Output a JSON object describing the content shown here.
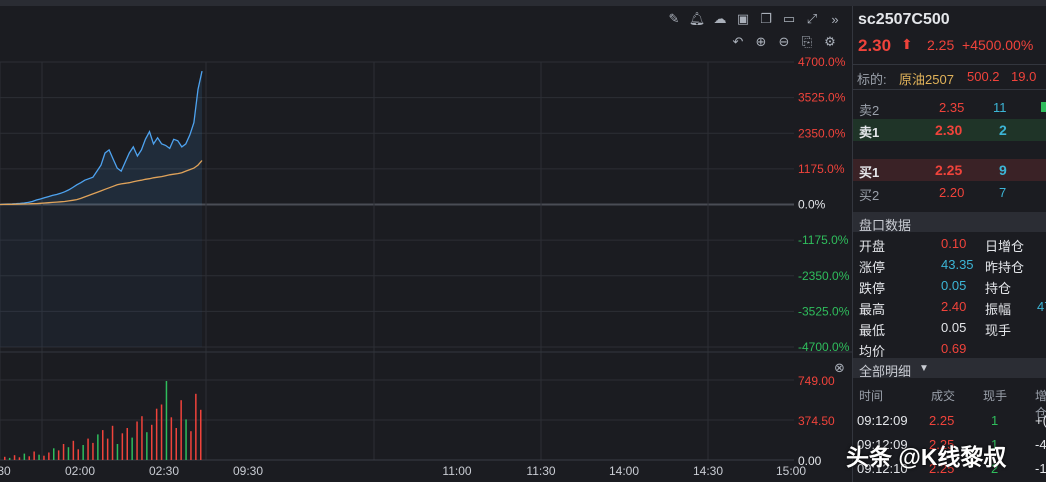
{
  "chart_data": {
    "type": "line",
    "x_ticks": [
      "30",
      "02:00",
      "02:30",
      "09:30",
      "11:00",
      "11:30",
      "14:00",
      "14:30",
      "15:00"
    ],
    "y_ticks_right": [
      "4700.0%",
      "3525.0%",
      "2350.0%",
      "1175.0%",
      "0.0%",
      "-1175.0%",
      "-2350.0%",
      "-3525.0%",
      "-4700.0%"
    ],
    "vol_ticks": [
      "749.00",
      "374.50",
      "0.00"
    ],
    "ylim": [
      -4700,
      4700
    ],
    "vol_max": 749,
    "series": [
      {
        "color": "#4ea3f0",
        "values": [
          0,
          10,
          15,
          20,
          25,
          35,
          50,
          70,
          100,
          150,
          180,
          220,
          260,
          300,
          330,
          370,
          420,
          480,
          560,
          650,
          720,
          800,
          850,
          900,
          1100,
          1300,
          1700,
          1800,
          1500,
          1200,
          1100,
          1400,
          1700,
          1900,
          1600,
          1800,
          2150,
          2400,
          2000,
          2200,
          2000,
          1950,
          1850,
          2150,
          2100,
          1900,
          2000,
          2300,
          2700,
          3800,
          4400
        ]
      },
      {
        "color": "#e0a35a",
        "values": [
          0,
          3,
          5,
          8,
          10,
          12,
          15,
          20,
          25,
          30,
          40,
          50,
          60,
          70,
          80,
          90,
          100,
          120,
          140,
          160,
          200,
          250,
          300,
          350,
          400,
          450,
          500,
          550,
          600,
          650,
          680,
          700,
          720,
          750,
          780,
          800,
          830,
          850,
          880,
          900,
          920,
          950,
          980,
          1000,
          1020,
          1050,
          1100,
          1150,
          1200,
          1300,
          1450
        ]
      }
    ],
    "volume": [
      {
        "v": 30,
        "c": "red"
      },
      {
        "v": 20,
        "c": "green"
      },
      {
        "v": 45,
        "c": "red"
      },
      {
        "v": 25,
        "c": "red"
      },
      {
        "v": 60,
        "c": "green"
      },
      {
        "v": 35,
        "c": "red"
      },
      {
        "v": 80,
        "c": "red"
      },
      {
        "v": 50,
        "c": "green"
      },
      {
        "v": 40,
        "c": "red"
      },
      {
        "v": 70,
        "c": "red"
      },
      {
        "v": 110,
        "c": "green"
      },
      {
        "v": 90,
        "c": "red"
      },
      {
        "v": 150,
        "c": "red"
      },
      {
        "v": 120,
        "c": "green"
      },
      {
        "v": 180,
        "c": "red"
      },
      {
        "v": 100,
        "c": "red"
      },
      {
        "v": 140,
        "c": "green"
      },
      {
        "v": 200,
        "c": "red"
      },
      {
        "v": 160,
        "c": "red"
      },
      {
        "v": 240,
        "c": "green"
      },
      {
        "v": 280,
        "c": "red"
      },
      {
        "v": 200,
        "c": "red"
      },
      {
        "v": 320,
        "c": "red"
      },
      {
        "v": 150,
        "c": "green"
      },
      {
        "v": 250,
        "c": "red"
      },
      {
        "v": 300,
        "c": "red"
      },
      {
        "v": 210,
        "c": "green"
      },
      {
        "v": 360,
        "c": "red"
      },
      {
        "v": 410,
        "c": "red"
      },
      {
        "v": 260,
        "c": "green"
      },
      {
        "v": 330,
        "c": "red"
      },
      {
        "v": 480,
        "c": "red"
      },
      {
        "v": 520,
        "c": "red"
      },
      {
        "v": 740,
        "c": "green"
      },
      {
        "v": 400,
        "c": "red"
      },
      {
        "v": 300,
        "c": "red"
      },
      {
        "v": 560,
        "c": "red"
      },
      {
        "v": 380,
        "c": "green"
      },
      {
        "v": 270,
        "c": "red"
      },
      {
        "v": 620,
        "c": "red"
      },
      {
        "v": 470,
        "c": "red"
      }
    ]
  },
  "header": {
    "symbol": "sc2507C500",
    "price": "2.30",
    "change": "2.25",
    "change_pct": "+4500.00%"
  },
  "underlying": {
    "label": "标的:",
    "name": "原油2507",
    "price": "500.2",
    "chg": "19.0"
  },
  "order_book": [
    {
      "label": "卖2",
      "price": "2.35",
      "qty": "11"
    },
    {
      "label": "卖1",
      "price": "2.30",
      "qty": "2"
    },
    {
      "label": "买1",
      "price": "2.25",
      "qty": "9"
    },
    {
      "label": "买2",
      "price": "2.20",
      "qty": "7"
    }
  ],
  "stats_title": "盘口数据",
  "stats_left": [
    {
      "label": "开盘",
      "value": "0.10",
      "color": "red"
    },
    {
      "label": "涨停",
      "value": "43.35",
      "color": "cyan"
    },
    {
      "label": "跌停",
      "value": "0.05",
      "color": "cyan"
    },
    {
      "label": "最高",
      "value": "2.40",
      "color": "red"
    },
    {
      "label": "最低",
      "value": "0.05",
      "color": "white"
    },
    {
      "label": "均价",
      "value": "0.69",
      "color": "red"
    }
  ],
  "stats_right_labels": [
    "日增仓",
    "昨持仓",
    "持仓",
    "振幅",
    "现手"
  ],
  "stats_right_partial": "47",
  "trades_title": "全部明细",
  "trades_headers": [
    "时间",
    "成交",
    "现手",
    "增仓"
  ],
  "trades": [
    {
      "time": "09:12:09",
      "price": "2.25",
      "qty": "1",
      "oi": "+("
    },
    {
      "time": "09:12:09",
      "price": "2.25",
      "qty": "1",
      "oi": "-4"
    },
    {
      "time": "09:12:10",
      "price": "2.25",
      "qty": "2",
      "oi": "-1"
    }
  ],
  "watermark": "头条 @K线黎叔",
  "icons": [
    "pen-icon",
    "bell-icon",
    "cloud-icon",
    "camera-icon",
    "copy-icon",
    "monitor-icon",
    "fullscreen-icon",
    "collapse-icon",
    "undo-icon",
    "zoom-in-icon",
    "zoom-out-icon",
    "save-icon",
    "settings-icon",
    "close-icon"
  ]
}
